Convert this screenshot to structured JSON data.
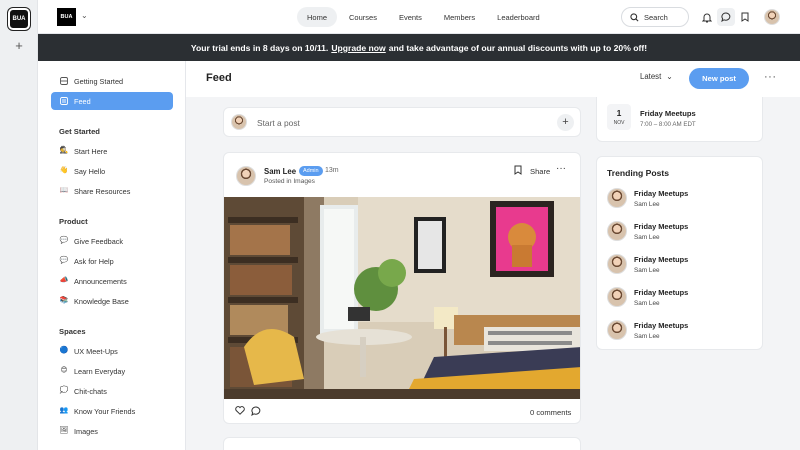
{
  "rail": {
    "logo_text": "BUA"
  },
  "header": {
    "brand_text": "BUA",
    "nav": [
      "Home",
      "Courses",
      "Events",
      "Members",
      "Leaderboard"
    ],
    "search_label": "Search"
  },
  "banner": {
    "before": "Your trial ends in 8 days on 10/11.",
    "link": "Upgrade now",
    "after": "and take advantage of our annual discounts with up to 20% off!"
  },
  "sidebar": {
    "top_items": [
      {
        "label": "Getting Started",
        "icon": "grid-icon"
      },
      {
        "label": "Feed",
        "icon": "feed-icon"
      }
    ],
    "sections": [
      {
        "title": "Get Started",
        "items": [
          {
            "label": "Start Here",
            "icon": "🕵"
          },
          {
            "label": "Say Hello",
            "icon": "👋"
          },
          {
            "label": "Share Resources",
            "icon": "📖"
          }
        ]
      },
      {
        "title": "Product",
        "items": [
          {
            "label": "Give Feedback",
            "icon": "💬"
          },
          {
            "label": "Ask for Help",
            "icon": "💬"
          },
          {
            "label": "Announcements",
            "icon": "📣"
          },
          {
            "label": "Knowledge Base",
            "icon": "📚"
          }
        ]
      },
      {
        "title": "Spaces",
        "items": [
          {
            "label": "UX Meet-Ups",
            "icon": "🔵"
          },
          {
            "label": "Learn Everyday",
            "icon": "😊"
          },
          {
            "label": "Chit-chats",
            "icon": "💭"
          },
          {
            "label": "Know Your Friends",
            "icon": "👥"
          },
          {
            "label": "Images",
            "icon": "🖼"
          }
        ]
      }
    ]
  },
  "main": {
    "title": "Feed",
    "sort_label": "Latest",
    "new_post_label": "New post",
    "start_post_placeholder": "Start a post",
    "post": {
      "author": "Sam Lee",
      "badge": "Admin",
      "time": "13m",
      "posted_in": "Posted in Images",
      "share_label": "Share",
      "comments_label": "0 comments"
    }
  },
  "right": {
    "event": {
      "day": "1",
      "month": "NOV",
      "title": "Friday Meetups",
      "time": "7:00 – 8:00 AM EDT"
    },
    "trending_title": "Trending Posts",
    "trending": [
      {
        "title": "Friday Meetups",
        "author": "Sam Lee"
      },
      {
        "title": "Friday Meetups",
        "author": "Sam Lee"
      },
      {
        "title": "Friday Meetups",
        "author": "Sam Lee"
      },
      {
        "title": "Friday Meetups",
        "author": "Sam Lee"
      },
      {
        "title": "Friday Meetups",
        "author": "Sam Lee"
      }
    ]
  },
  "colors": {
    "accent": "#5b9df0",
    "banner_bg": "#2b2f33",
    "admin_badge": "#5b9df0"
  }
}
